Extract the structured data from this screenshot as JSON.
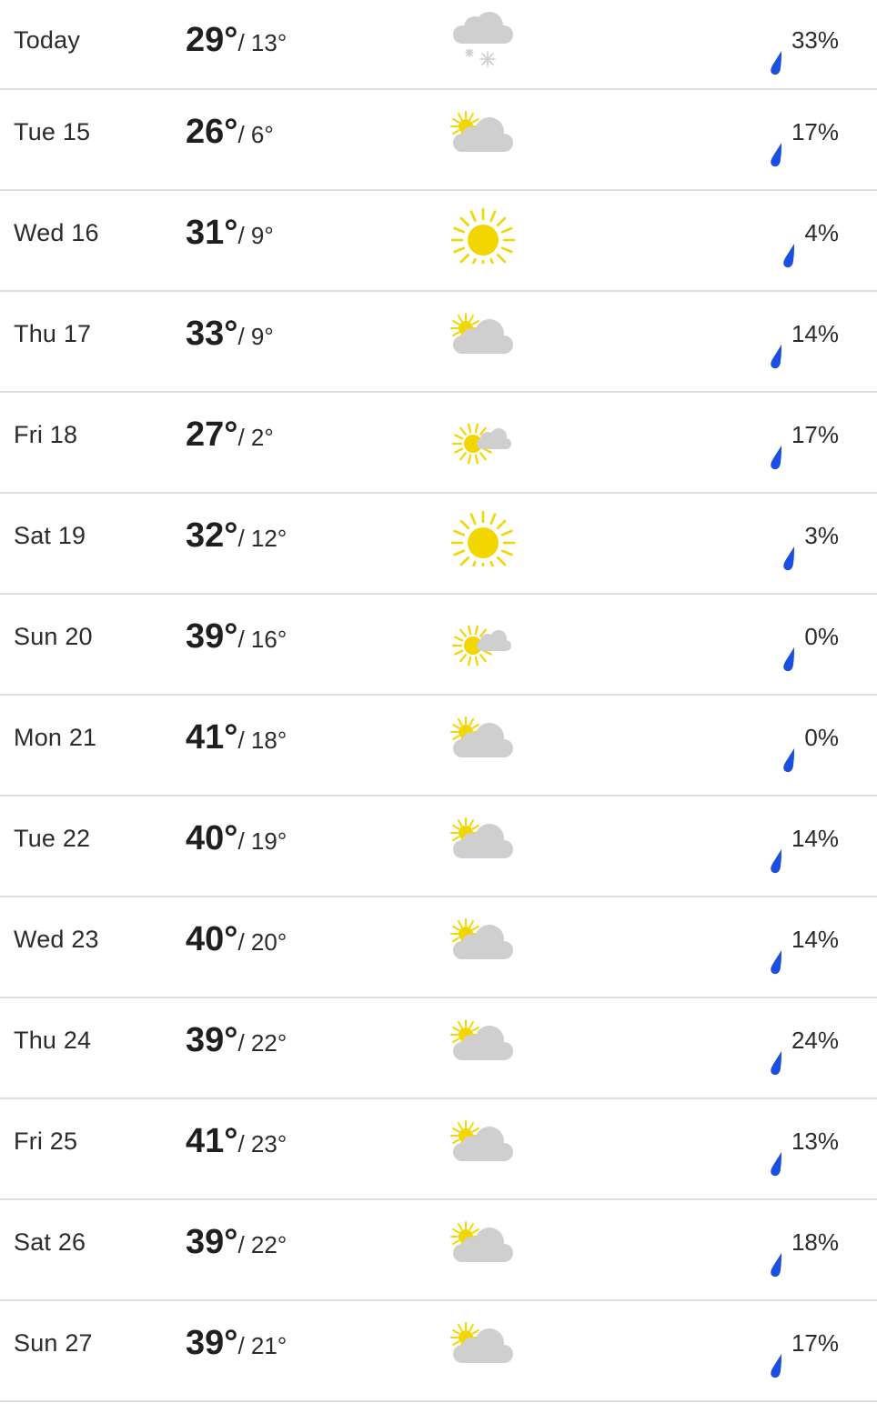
{
  "colors": {
    "sun": "#f2d600",
    "cloud": "#cfcfcf",
    "drop": "#1a4fe0",
    "divider": "#dedede",
    "text": "#2b2b2b"
  },
  "forecast": [
    {
      "day": "Today",
      "high": "29°",
      "low": "/ 13°",
      "icon": "snow-cloud-icon",
      "precip": "33%"
    },
    {
      "day": "Tue 15",
      "high": "26°",
      "low": "/ 6°",
      "icon": "partly-cloudy-icon",
      "precip": "17%"
    },
    {
      "day": "Wed 16",
      "high": "31°",
      "low": "/ 9°",
      "icon": "sun-icon",
      "precip": "4%"
    },
    {
      "day": "Thu 17",
      "high": "33°",
      "low": "/ 9°",
      "icon": "partly-cloudy-icon",
      "precip": "14%"
    },
    {
      "day": "Fri 18",
      "high": "27°",
      "low": "/ 2°",
      "icon": "mostly-sunny-icon",
      "precip": "17%"
    },
    {
      "day": "Sat 19",
      "high": "32°",
      "low": "/ 12°",
      "icon": "sun-icon",
      "precip": "3%"
    },
    {
      "day": "Sun 20",
      "high": "39°",
      "low": "/ 16°",
      "icon": "mostly-sunny-icon",
      "precip": "0%"
    },
    {
      "day": "Mon 21",
      "high": "41°",
      "low": "/ 18°",
      "icon": "partly-cloudy-icon",
      "precip": "0%"
    },
    {
      "day": "Tue 22",
      "high": "40°",
      "low": "/ 19°",
      "icon": "partly-cloudy-icon",
      "precip": "14%"
    },
    {
      "day": "Wed 23",
      "high": "40°",
      "low": "/ 20°",
      "icon": "partly-cloudy-icon",
      "precip": "14%"
    },
    {
      "day": "Thu 24",
      "high": "39°",
      "low": "/ 22°",
      "icon": "partly-cloudy-icon",
      "precip": "24%"
    },
    {
      "day": "Fri 25",
      "high": "41°",
      "low": "/ 23°",
      "icon": "partly-cloudy-icon",
      "precip": "13%"
    },
    {
      "day": "Sat 26",
      "high": "39°",
      "low": "/ 22°",
      "icon": "partly-cloudy-icon",
      "precip": "18%"
    },
    {
      "day": "Sun 27",
      "high": "39°",
      "low": "/ 21°",
      "icon": "partly-cloudy-icon",
      "precip": "17%"
    }
  ]
}
